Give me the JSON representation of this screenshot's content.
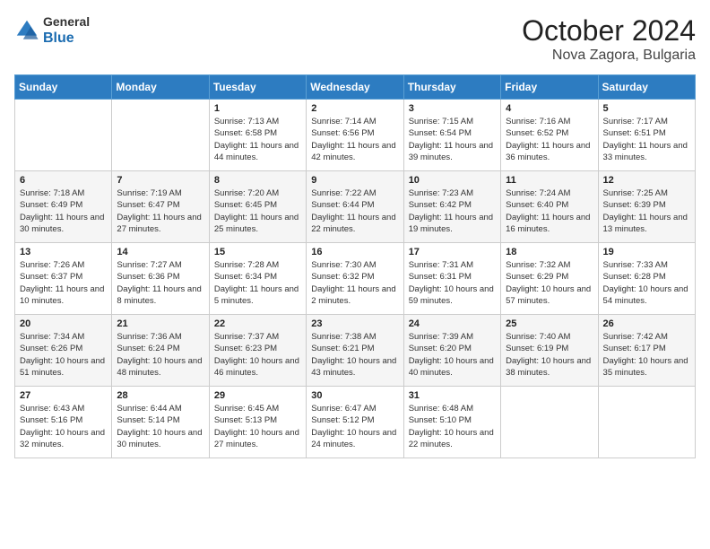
{
  "logo": {
    "general": "General",
    "blue": "Blue"
  },
  "header": {
    "month_year": "October 2024",
    "location": "Nova Zagora, Bulgaria"
  },
  "weekdays": [
    "Sunday",
    "Monday",
    "Tuesday",
    "Wednesday",
    "Thursday",
    "Friday",
    "Saturday"
  ],
  "weeks": [
    [
      {
        "day": "",
        "sunrise": "",
        "sunset": "",
        "daylight": ""
      },
      {
        "day": "",
        "sunrise": "",
        "sunset": "",
        "daylight": ""
      },
      {
        "day": "1",
        "sunrise": "Sunrise: 7:13 AM",
        "sunset": "Sunset: 6:58 PM",
        "daylight": "Daylight: 11 hours and 44 minutes."
      },
      {
        "day": "2",
        "sunrise": "Sunrise: 7:14 AM",
        "sunset": "Sunset: 6:56 PM",
        "daylight": "Daylight: 11 hours and 42 minutes."
      },
      {
        "day": "3",
        "sunrise": "Sunrise: 7:15 AM",
        "sunset": "Sunset: 6:54 PM",
        "daylight": "Daylight: 11 hours and 39 minutes."
      },
      {
        "day": "4",
        "sunrise": "Sunrise: 7:16 AM",
        "sunset": "Sunset: 6:52 PM",
        "daylight": "Daylight: 11 hours and 36 minutes."
      },
      {
        "day": "5",
        "sunrise": "Sunrise: 7:17 AM",
        "sunset": "Sunset: 6:51 PM",
        "daylight": "Daylight: 11 hours and 33 minutes."
      }
    ],
    [
      {
        "day": "6",
        "sunrise": "Sunrise: 7:18 AM",
        "sunset": "Sunset: 6:49 PM",
        "daylight": "Daylight: 11 hours and 30 minutes."
      },
      {
        "day": "7",
        "sunrise": "Sunrise: 7:19 AM",
        "sunset": "Sunset: 6:47 PM",
        "daylight": "Daylight: 11 hours and 27 minutes."
      },
      {
        "day": "8",
        "sunrise": "Sunrise: 7:20 AM",
        "sunset": "Sunset: 6:45 PM",
        "daylight": "Daylight: 11 hours and 25 minutes."
      },
      {
        "day": "9",
        "sunrise": "Sunrise: 7:22 AM",
        "sunset": "Sunset: 6:44 PM",
        "daylight": "Daylight: 11 hours and 22 minutes."
      },
      {
        "day": "10",
        "sunrise": "Sunrise: 7:23 AM",
        "sunset": "Sunset: 6:42 PM",
        "daylight": "Daylight: 11 hours and 19 minutes."
      },
      {
        "day": "11",
        "sunrise": "Sunrise: 7:24 AM",
        "sunset": "Sunset: 6:40 PM",
        "daylight": "Daylight: 11 hours and 16 minutes."
      },
      {
        "day": "12",
        "sunrise": "Sunrise: 7:25 AM",
        "sunset": "Sunset: 6:39 PM",
        "daylight": "Daylight: 11 hours and 13 minutes."
      }
    ],
    [
      {
        "day": "13",
        "sunrise": "Sunrise: 7:26 AM",
        "sunset": "Sunset: 6:37 PM",
        "daylight": "Daylight: 11 hours and 10 minutes."
      },
      {
        "day": "14",
        "sunrise": "Sunrise: 7:27 AM",
        "sunset": "Sunset: 6:36 PM",
        "daylight": "Daylight: 11 hours and 8 minutes."
      },
      {
        "day": "15",
        "sunrise": "Sunrise: 7:28 AM",
        "sunset": "Sunset: 6:34 PM",
        "daylight": "Daylight: 11 hours and 5 minutes."
      },
      {
        "day": "16",
        "sunrise": "Sunrise: 7:30 AM",
        "sunset": "Sunset: 6:32 PM",
        "daylight": "Daylight: 11 hours and 2 minutes."
      },
      {
        "day": "17",
        "sunrise": "Sunrise: 7:31 AM",
        "sunset": "Sunset: 6:31 PM",
        "daylight": "Daylight: 10 hours and 59 minutes."
      },
      {
        "day": "18",
        "sunrise": "Sunrise: 7:32 AM",
        "sunset": "Sunset: 6:29 PM",
        "daylight": "Daylight: 10 hours and 57 minutes."
      },
      {
        "day": "19",
        "sunrise": "Sunrise: 7:33 AM",
        "sunset": "Sunset: 6:28 PM",
        "daylight": "Daylight: 10 hours and 54 minutes."
      }
    ],
    [
      {
        "day": "20",
        "sunrise": "Sunrise: 7:34 AM",
        "sunset": "Sunset: 6:26 PM",
        "daylight": "Daylight: 10 hours and 51 minutes."
      },
      {
        "day": "21",
        "sunrise": "Sunrise: 7:36 AM",
        "sunset": "Sunset: 6:24 PM",
        "daylight": "Daylight: 10 hours and 48 minutes."
      },
      {
        "day": "22",
        "sunrise": "Sunrise: 7:37 AM",
        "sunset": "Sunset: 6:23 PM",
        "daylight": "Daylight: 10 hours and 46 minutes."
      },
      {
        "day": "23",
        "sunrise": "Sunrise: 7:38 AM",
        "sunset": "Sunset: 6:21 PM",
        "daylight": "Daylight: 10 hours and 43 minutes."
      },
      {
        "day": "24",
        "sunrise": "Sunrise: 7:39 AM",
        "sunset": "Sunset: 6:20 PM",
        "daylight": "Daylight: 10 hours and 40 minutes."
      },
      {
        "day": "25",
        "sunrise": "Sunrise: 7:40 AM",
        "sunset": "Sunset: 6:19 PM",
        "daylight": "Daylight: 10 hours and 38 minutes."
      },
      {
        "day": "26",
        "sunrise": "Sunrise: 7:42 AM",
        "sunset": "Sunset: 6:17 PM",
        "daylight": "Daylight: 10 hours and 35 minutes."
      }
    ],
    [
      {
        "day": "27",
        "sunrise": "Sunrise: 6:43 AM",
        "sunset": "Sunset: 5:16 PM",
        "daylight": "Daylight: 10 hours and 32 minutes."
      },
      {
        "day": "28",
        "sunrise": "Sunrise: 6:44 AM",
        "sunset": "Sunset: 5:14 PM",
        "daylight": "Daylight: 10 hours and 30 minutes."
      },
      {
        "day": "29",
        "sunrise": "Sunrise: 6:45 AM",
        "sunset": "Sunset: 5:13 PM",
        "daylight": "Daylight: 10 hours and 27 minutes."
      },
      {
        "day": "30",
        "sunrise": "Sunrise: 6:47 AM",
        "sunset": "Sunset: 5:12 PM",
        "daylight": "Daylight: 10 hours and 24 minutes."
      },
      {
        "day": "31",
        "sunrise": "Sunrise: 6:48 AM",
        "sunset": "Sunset: 5:10 PM",
        "daylight": "Daylight: 10 hours and 22 minutes."
      },
      {
        "day": "",
        "sunrise": "",
        "sunset": "",
        "daylight": ""
      },
      {
        "day": "",
        "sunrise": "",
        "sunset": "",
        "daylight": ""
      }
    ]
  ]
}
